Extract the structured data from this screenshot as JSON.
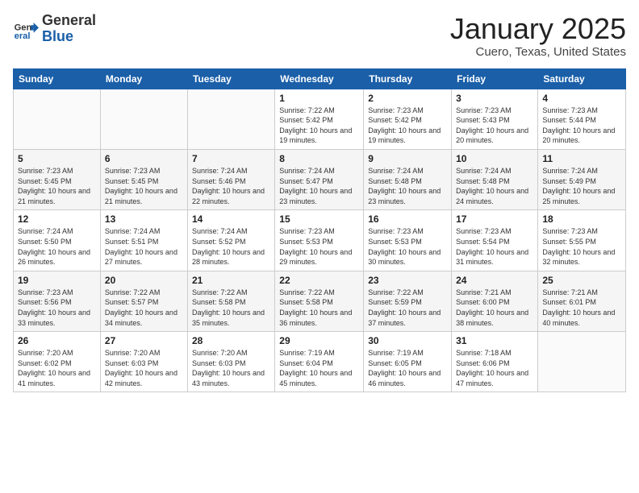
{
  "logo": {
    "general": "General",
    "blue": "Blue"
  },
  "title": "January 2025",
  "subtitle": "Cuero, Texas, United States",
  "days_of_week": [
    "Sunday",
    "Monday",
    "Tuesday",
    "Wednesday",
    "Thursday",
    "Friday",
    "Saturday"
  ],
  "weeks": [
    [
      {
        "day": "",
        "info": ""
      },
      {
        "day": "",
        "info": ""
      },
      {
        "day": "",
        "info": ""
      },
      {
        "day": "1",
        "info": "Sunrise: 7:22 AM\nSunset: 5:42 PM\nDaylight: 10 hours and 19 minutes."
      },
      {
        "day": "2",
        "info": "Sunrise: 7:23 AM\nSunset: 5:42 PM\nDaylight: 10 hours and 19 minutes."
      },
      {
        "day": "3",
        "info": "Sunrise: 7:23 AM\nSunset: 5:43 PM\nDaylight: 10 hours and 20 minutes."
      },
      {
        "day": "4",
        "info": "Sunrise: 7:23 AM\nSunset: 5:44 PM\nDaylight: 10 hours and 20 minutes."
      }
    ],
    [
      {
        "day": "5",
        "info": "Sunrise: 7:23 AM\nSunset: 5:45 PM\nDaylight: 10 hours and 21 minutes."
      },
      {
        "day": "6",
        "info": "Sunrise: 7:23 AM\nSunset: 5:45 PM\nDaylight: 10 hours and 21 minutes."
      },
      {
        "day": "7",
        "info": "Sunrise: 7:24 AM\nSunset: 5:46 PM\nDaylight: 10 hours and 22 minutes."
      },
      {
        "day": "8",
        "info": "Sunrise: 7:24 AM\nSunset: 5:47 PM\nDaylight: 10 hours and 23 minutes."
      },
      {
        "day": "9",
        "info": "Sunrise: 7:24 AM\nSunset: 5:48 PM\nDaylight: 10 hours and 23 minutes."
      },
      {
        "day": "10",
        "info": "Sunrise: 7:24 AM\nSunset: 5:48 PM\nDaylight: 10 hours and 24 minutes."
      },
      {
        "day": "11",
        "info": "Sunrise: 7:24 AM\nSunset: 5:49 PM\nDaylight: 10 hours and 25 minutes."
      }
    ],
    [
      {
        "day": "12",
        "info": "Sunrise: 7:24 AM\nSunset: 5:50 PM\nDaylight: 10 hours and 26 minutes."
      },
      {
        "day": "13",
        "info": "Sunrise: 7:24 AM\nSunset: 5:51 PM\nDaylight: 10 hours and 27 minutes."
      },
      {
        "day": "14",
        "info": "Sunrise: 7:24 AM\nSunset: 5:52 PM\nDaylight: 10 hours and 28 minutes."
      },
      {
        "day": "15",
        "info": "Sunrise: 7:23 AM\nSunset: 5:53 PM\nDaylight: 10 hours and 29 minutes."
      },
      {
        "day": "16",
        "info": "Sunrise: 7:23 AM\nSunset: 5:53 PM\nDaylight: 10 hours and 30 minutes."
      },
      {
        "day": "17",
        "info": "Sunrise: 7:23 AM\nSunset: 5:54 PM\nDaylight: 10 hours and 31 minutes."
      },
      {
        "day": "18",
        "info": "Sunrise: 7:23 AM\nSunset: 5:55 PM\nDaylight: 10 hours and 32 minutes."
      }
    ],
    [
      {
        "day": "19",
        "info": "Sunrise: 7:23 AM\nSunset: 5:56 PM\nDaylight: 10 hours and 33 minutes."
      },
      {
        "day": "20",
        "info": "Sunrise: 7:22 AM\nSunset: 5:57 PM\nDaylight: 10 hours and 34 minutes."
      },
      {
        "day": "21",
        "info": "Sunrise: 7:22 AM\nSunset: 5:58 PM\nDaylight: 10 hours and 35 minutes."
      },
      {
        "day": "22",
        "info": "Sunrise: 7:22 AM\nSunset: 5:58 PM\nDaylight: 10 hours and 36 minutes."
      },
      {
        "day": "23",
        "info": "Sunrise: 7:22 AM\nSunset: 5:59 PM\nDaylight: 10 hours and 37 minutes."
      },
      {
        "day": "24",
        "info": "Sunrise: 7:21 AM\nSunset: 6:00 PM\nDaylight: 10 hours and 38 minutes."
      },
      {
        "day": "25",
        "info": "Sunrise: 7:21 AM\nSunset: 6:01 PM\nDaylight: 10 hours and 40 minutes."
      }
    ],
    [
      {
        "day": "26",
        "info": "Sunrise: 7:20 AM\nSunset: 6:02 PM\nDaylight: 10 hours and 41 minutes."
      },
      {
        "day": "27",
        "info": "Sunrise: 7:20 AM\nSunset: 6:03 PM\nDaylight: 10 hours and 42 minutes."
      },
      {
        "day": "28",
        "info": "Sunrise: 7:20 AM\nSunset: 6:03 PM\nDaylight: 10 hours and 43 minutes."
      },
      {
        "day": "29",
        "info": "Sunrise: 7:19 AM\nSunset: 6:04 PM\nDaylight: 10 hours and 45 minutes."
      },
      {
        "day": "30",
        "info": "Sunrise: 7:19 AM\nSunset: 6:05 PM\nDaylight: 10 hours and 46 minutes."
      },
      {
        "day": "31",
        "info": "Sunrise: 7:18 AM\nSunset: 6:06 PM\nDaylight: 10 hours and 47 minutes."
      },
      {
        "day": "",
        "info": ""
      }
    ]
  ]
}
